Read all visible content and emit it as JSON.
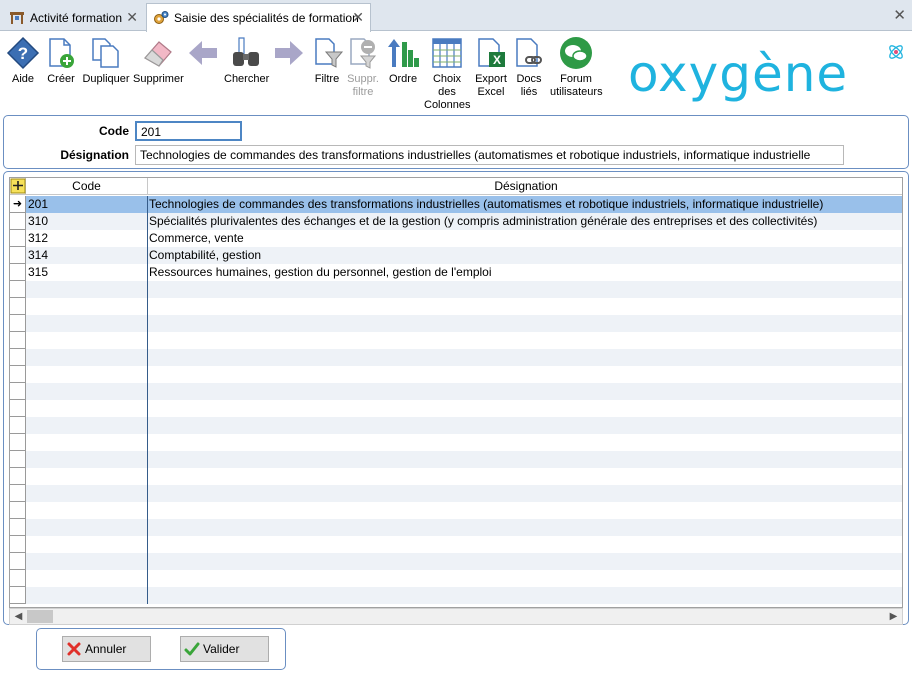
{
  "tabs": [
    {
      "label": "Activité formation",
      "icon": "workbench-icon",
      "active": false
    },
    {
      "label": "Saisie des spécialités de formation",
      "icon": "gears-icon",
      "active": true
    }
  ],
  "toolbar": {
    "aide": "Aide",
    "creer": "Créer",
    "dupliquer": "Dupliquer",
    "supprimer": "Supprimer",
    "chercher": "Chercher",
    "filtre": "Filtre",
    "suppr_filtre_1": "Suppr.",
    "suppr_filtre_2": "filtre",
    "ordre": "Ordre",
    "choix_1": "Choix",
    "choix_2": "des",
    "choix_3": "Colonnes",
    "export_1": "Export",
    "export_2": "Excel",
    "docs_1": "Docs",
    "docs_2": "liés",
    "forum_1": "Forum",
    "forum_2": "utilisateurs"
  },
  "logo": "oxygène",
  "form": {
    "code_label": "Code",
    "code_value": "201",
    "designation_label": "Désignation",
    "designation_value": "Technologies de commandes des transformations industrielles (automatismes et robotique industriels, informatique industrielle"
  },
  "grid": {
    "col_code": "Code",
    "col_designation": "Désignation",
    "rows": [
      {
        "code": "201",
        "designation": "Technologies de commandes des transformations industrielles (automatismes et robotique industriels, informatique industrielle)"
      },
      {
        "code": "310",
        "designation": "Spécialités plurivalentes des échanges et de la gestion (y compris administration générale des entreprises et des collectivités)"
      },
      {
        "code": "312",
        "designation": "Commerce, vente"
      },
      {
        "code": "314",
        "designation": "Comptabilité, gestion"
      },
      {
        "code": "315",
        "designation": "Ressources humaines, gestion du personnel, gestion de l'emploi"
      }
    ]
  },
  "buttons": {
    "annuler": "Annuler",
    "valider": "Valider"
  },
  "colors": {
    "selection": "#99c0ea",
    "accent_border": "#6b8fc2",
    "logo": "#1fb3df"
  }
}
